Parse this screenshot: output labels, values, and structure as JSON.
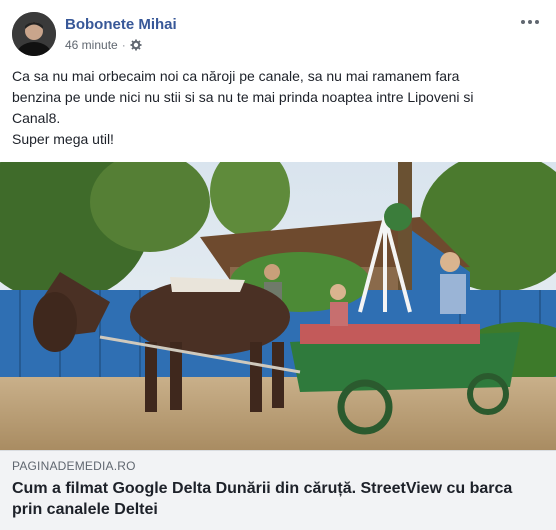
{
  "post": {
    "author": "Bobonete Mihai",
    "time": "46 minute",
    "audience_icon": "gear-icon",
    "more_icon": "more-options-icon",
    "text_lines": [
      "Ca sa nu mai orbecaim noi ca năroji pe canale, sa nu mai ramanem fara",
      "benzina pe unde nici nu stii si sa nu te mai prinda noaptea intre Lipoveni si",
      "Canal8.",
      "Super mega util!"
    ]
  },
  "link": {
    "domain": "PAGINADEMEDIA.RO",
    "title": "Cum a filmat Google Delta Dunării din căruță. StreetView cu barca prin canalele Deltei"
  },
  "colors": {
    "author_link": "#385898",
    "text": "#1d2129",
    "secondary": "#606770",
    "link_bg": "#f2f3f5"
  }
}
